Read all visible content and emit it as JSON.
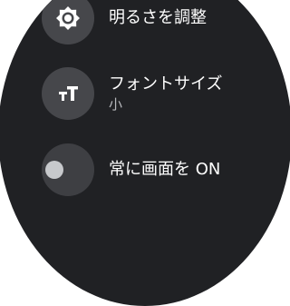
{
  "settings": {
    "items": [
      {
        "label": "明るさを調整",
        "icon": "brightness-icon"
      },
      {
        "label": "フォントサイズ",
        "value": "小",
        "icon": "font-size-icon"
      },
      {
        "label": "常に画面を ON",
        "icon": "toggle-switch",
        "toggle_state": "off"
      }
    ]
  },
  "colors": {
    "background": "#202124",
    "icon_circle": "#46474b",
    "text": "#ffffff",
    "subtext": "#b7b9bd"
  }
}
